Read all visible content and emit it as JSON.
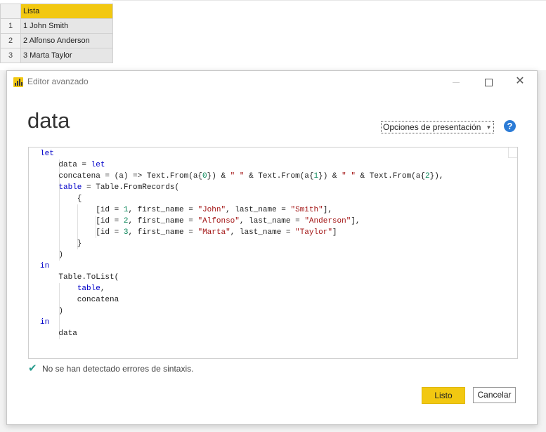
{
  "table": {
    "column_header": "Lista",
    "rows": [
      {
        "index": "1",
        "value": "1 John Smith"
      },
      {
        "index": "2",
        "value": "2 Alfonso Anderson"
      },
      {
        "index": "3",
        "value": "3 Marta Taylor"
      }
    ]
  },
  "dialog": {
    "title": "Editor avanzado",
    "query_name": "data",
    "options_label": "Opciones de presentación",
    "help_icon": "?",
    "status_text": "No se han detectado errores de sintaxis.",
    "ok_label": "Listo",
    "cancel_label": "Cancelar"
  },
  "colors": {
    "accent": "#f2c811",
    "keyword": "#0000c8",
    "number": "#098658",
    "string": "#a31515",
    "check": "#2a9d8f",
    "help": "#2b7bd6"
  },
  "code_lines": [
    "let",
    "    data = let",
    "    concatena = (a) => Text.From(a{0}) & \" \" & Text.From(a{1}) & \" \" & Text.From(a{2}),",
    "    table = Table.FromRecords(",
    "        {",
    "            [id = 1, first_name = \"John\", last_name = \"Smith\"],",
    "            [id = 2, first_name = \"Alfonso\", last_name = \"Anderson\"],",
    "            [id = 3, first_name = \"Marta\", last_name = \"Taylor\"]",
    "        }",
    "    )",
    "in",
    "    Table.ToList(",
    "        table,",
    "        concatena",
    "    )",
    "in",
    "    data"
  ]
}
